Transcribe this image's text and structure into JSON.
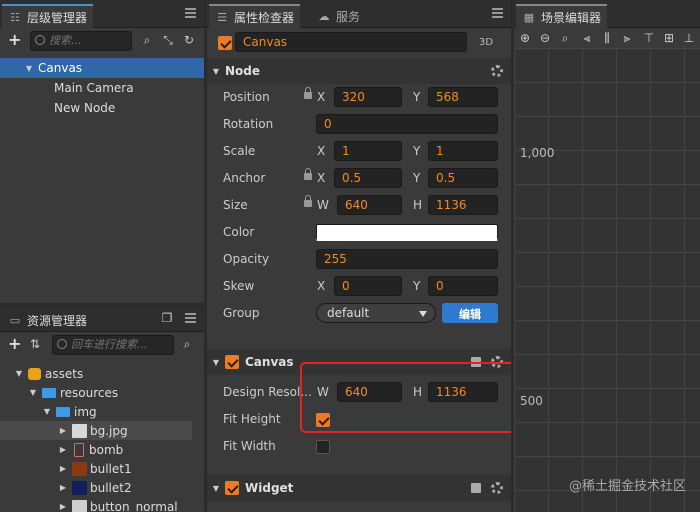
{
  "hierarchy": {
    "tab_label": "层级管理器",
    "search_placeholder": "搜索...",
    "nodes": [
      {
        "label": "Canvas",
        "selected": true,
        "expanded": true
      },
      {
        "label": "Main Camera"
      },
      {
        "label": "New Node"
      }
    ]
  },
  "assets": {
    "tab_label": "资源管理器",
    "search_placeholder": "回车进行搜索...",
    "items": [
      {
        "label": "assets",
        "level": 0
      },
      {
        "label": "resources",
        "level": 1
      },
      {
        "label": "img",
        "level": 2
      },
      {
        "label": "bg.jpg",
        "level": 3,
        "selected": true
      },
      {
        "label": "bomb",
        "level": 3
      },
      {
        "label": "bullet1",
        "level": 3
      },
      {
        "label": "bullet2",
        "level": 3
      },
      {
        "label": "button_normal",
        "level": 3
      }
    ]
  },
  "inspector": {
    "tab_label": "属性检查器",
    "tab2_label": "服务",
    "node_name": "Canvas",
    "mode_3d": "3D",
    "node_section": "Node",
    "position": {
      "label": "Position",
      "x_label": "X",
      "x": "320",
      "y_label": "Y",
      "y": "568"
    },
    "rotation": {
      "label": "Rotation",
      "value": "0"
    },
    "scale": {
      "label": "Scale",
      "x_label": "X",
      "x": "1",
      "y_label": "Y",
      "y": "1"
    },
    "anchor": {
      "label": "Anchor",
      "x_label": "X",
      "x": "0.5",
      "y_label": "Y",
      "y": "0.5"
    },
    "size": {
      "label": "Size",
      "w_label": "W",
      "w": "640",
      "h_label": "H",
      "h": "1136"
    },
    "color": {
      "label": "Color",
      "value": "#ffffff"
    },
    "opacity": {
      "label": "Opacity",
      "value": "255"
    },
    "skew": {
      "label": "Skew",
      "x_label": "X",
      "x": "0",
      "y_label": "Y",
      "y": "0"
    },
    "group": {
      "label": "Group",
      "value": "default",
      "edit_label": "编辑"
    },
    "canvas_section": "Canvas",
    "design_resolution": {
      "label": "Design Resol...",
      "w_label": "W",
      "w": "640",
      "h_label": "H",
      "h": "1136"
    },
    "fit_height": {
      "label": "Fit Height",
      "checked": true
    },
    "fit_width": {
      "label": "Fit Width",
      "checked": false
    },
    "widget_section": "Widget"
  },
  "scene": {
    "tab_label": "场景编辑器",
    "ruler_1000": "1,000",
    "ruler_500": "500"
  },
  "watermark": "@稀土掘金技术社区",
  "colors": {
    "accent": "#2f67a8",
    "value_orange": "#f08a24",
    "highlight_red": "#e0262b"
  }
}
